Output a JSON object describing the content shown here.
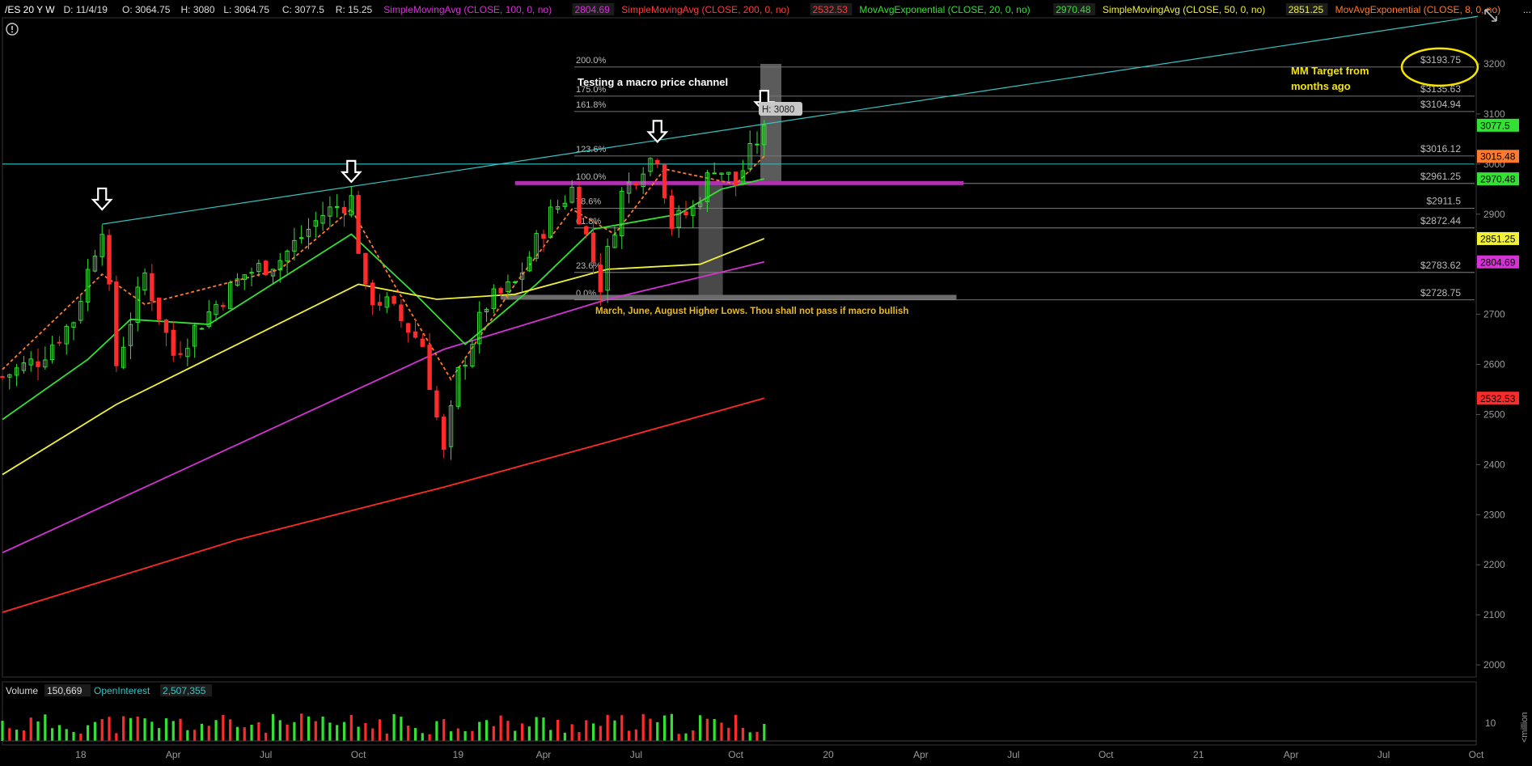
{
  "header": {
    "symbol": "/ES 20 Y W",
    "ohlc": [
      {
        "text": "D: 11/4/19",
        "color": "#dddddd"
      },
      {
        "text": "O: 3064.75",
        "color": "#dddddd"
      },
      {
        "text": "H: 3080",
        "color": "#dddddd"
      },
      {
        "text": "L: 3064.75",
        "color": "#dddddd"
      },
      {
        "text": "C: 3077.5",
        "color": "#dddddd"
      },
      {
        "text": "R: 15.25",
        "color": "#dddddd"
      }
    ],
    "studies": [
      {
        "label": "SimpleMovingAvg (CLOSE, 100, 0, no)",
        "value": "2804.69",
        "color": "#d633d6"
      },
      {
        "label": "SimpleMovingAvg (CLOSE, 200, 0, no)",
        "value": "2532.53",
        "color": "#ff3b3b"
      },
      {
        "label": "MovAvgExponential (CLOSE, 20, 0, no)",
        "value": "2970.48",
        "color": "#35e035"
      },
      {
        "label": "SimpleMovingAvg (CLOSE, 50, 0, no)",
        "value": "2851.25",
        "color": "#f0f03a"
      },
      {
        "label": "MovAvgExponential (CLOSE, 8, 0, no)",
        "value": "",
        "color": "#ff7a2a"
      }
    ],
    "more": "..."
  },
  "info_icon": "alert-circle-icon",
  "collapse_icon": "collapse-arrows-icon",
  "chart_data": {
    "type": "candlestick",
    "timeframe": "Weekly",
    "price_axis": {
      "range": [
        1950,
        3290
      ],
      "ticks": [
        2000,
        2100,
        2200,
        2300,
        2400,
        2500,
        2600,
        2700,
        2800,
        2900,
        3000,
        3100,
        3200
      ]
    },
    "x_axis": {
      "range": [
        "2017-10-16",
        "2021-10-04"
      ],
      "ticks": [
        {
          "label": "18",
          "date": "2018-01-01"
        },
        {
          "label": "Apr",
          "date": "2018-04-02"
        },
        {
          "label": "Jul",
          "date": "2018-07-02"
        },
        {
          "label": "Oct",
          "date": "2018-10-01"
        },
        {
          "label": "19",
          "date": "2019-01-07"
        },
        {
          "label": "Apr",
          "date": "2019-04-01"
        },
        {
          "label": "Jul",
          "date": "2019-07-01"
        },
        {
          "label": "Oct",
          "date": "2019-10-07"
        },
        {
          "label": "20",
          "date": "2020-01-06"
        },
        {
          "label": "Apr",
          "date": "2020-04-06"
        },
        {
          "label": "Jul",
          "date": "2020-07-06"
        },
        {
          "label": "Oct",
          "date": "2020-10-05"
        },
        {
          "label": "21",
          "date": "2021-01-04"
        },
        {
          "label": "Apr",
          "date": "2021-04-05"
        },
        {
          "label": "Jul",
          "date": "2021-07-05"
        },
        {
          "label": "Oct",
          "date": "2021-10-04"
        }
      ]
    },
    "price_path": [
      {
        "date": "2017-10-16",
        "close": 2575
      },
      {
        "date": "2017-11-20",
        "close": 2610
      },
      {
        "date": "2017-12-25",
        "close": 2690
      },
      {
        "date": "2018-01-22",
        "close": 2880
      },
      {
        "date": "2018-02-05",
        "close": 2600
      },
      {
        "date": "2018-03-05",
        "close": 2780
      },
      {
        "date": "2018-04-02",
        "close": 2620
      },
      {
        "date": "2018-05-14",
        "close": 2720
      },
      {
        "date": "2018-06-11",
        "close": 2780
      },
      {
        "date": "2018-07-16",
        "close": 2810
      },
      {
        "date": "2018-08-27",
        "close": 2900
      },
      {
        "date": "2018-09-24",
        "close": 2930
      },
      {
        "date": "2018-10-08",
        "close": 2740
      },
      {
        "date": "2018-10-29",
        "close": 2720
      },
      {
        "date": "2018-12-03",
        "close": 2640
      },
      {
        "date": "2018-12-24",
        "close": 2420
      },
      {
        "date": "2019-01-07",
        "close": 2580
      },
      {
        "date": "2019-02-04",
        "close": 2720
      },
      {
        "date": "2019-03-04",
        "close": 2760
      },
      {
        "date": "2019-04-08",
        "close": 2900
      },
      {
        "date": "2019-04-29",
        "close": 2950
      },
      {
        "date": "2019-05-27",
        "close": 2760
      },
      {
        "date": "2019-06-17",
        "close": 2940
      },
      {
        "date": "2019-07-08",
        "close": 3000
      },
      {
        "date": "2019-07-22",
        "close": 3020
      },
      {
        "date": "2019-08-05",
        "close": 2880
      },
      {
        "date": "2019-08-26",
        "close": 2910
      },
      {
        "date": "2019-09-16",
        "close": 3000
      },
      {
        "date": "2019-10-07",
        "close": 2960
      },
      {
        "date": "2019-10-21",
        "close": 3020
      },
      {
        "date": "2019-11-04",
        "close": 3077.5
      }
    ],
    "moving_averages": [
      {
        "name": "SimpleMovingAvg (CLOSE, 100, 0, no)",
        "color": "#d633d6",
        "points": [
          [
            "2017-10-16",
            2224
          ],
          [
            "2018-06-04",
            2440
          ],
          [
            "2018-12-24",
            2630
          ],
          [
            "2019-06-03",
            2730
          ],
          [
            "2019-11-04",
            2804.69
          ]
        ]
      },
      {
        "name": "SimpleMovingAvg (CLOSE, 200, 0, no)",
        "color": "#ff2a2a",
        "points": [
          [
            "2017-10-16",
            2105
          ],
          [
            "2018-06-04",
            2250
          ],
          [
            "2018-12-24",
            2355
          ],
          [
            "2019-06-03",
            2445
          ],
          [
            "2019-11-04",
            2532.53
          ]
        ]
      },
      {
        "name": "MovAvgExponential (CLOSE, 20, 0, no)",
        "color": "#35e035",
        "points": [
          [
            "2017-10-16",
            2490
          ],
          [
            "2018-01-08",
            2610
          ],
          [
            "2018-02-19",
            2690
          ],
          [
            "2018-05-07",
            2680
          ],
          [
            "2018-09-24",
            2860
          ],
          [
            "2018-11-26",
            2740
          ],
          [
            "2019-01-14",
            2640
          ],
          [
            "2019-03-25",
            2760
          ],
          [
            "2019-05-20",
            2870
          ],
          [
            "2019-08-12",
            2900
          ],
          [
            "2019-09-23",
            2950
          ],
          [
            "2019-11-04",
            2970.48
          ]
        ]
      },
      {
        "name": "SimpleMovingAvg (CLOSE, 50, 0, no)",
        "color": "#f0f03a",
        "points": [
          [
            "2017-10-16",
            2380
          ],
          [
            "2018-02-05",
            2520
          ],
          [
            "2018-06-04",
            2640
          ],
          [
            "2018-10-01",
            2760
          ],
          [
            "2018-12-17",
            2730
          ],
          [
            "2019-03-04",
            2740
          ],
          [
            "2019-06-03",
            2790
          ],
          [
            "2019-09-02",
            2800
          ],
          [
            "2019-11-04",
            2851.25
          ]
        ]
      },
      {
        "name": "MovAvgExponential (CLOSE, 8, 0, no)",
        "color": "#ff7a2a",
        "dashed": true,
        "points": [
          [
            "2017-10-16",
            2590
          ],
          [
            "2018-01-22",
            2780
          ],
          [
            "2018-03-05",
            2720
          ],
          [
            "2018-07-16",
            2790
          ],
          [
            "2018-09-24",
            2910
          ],
          [
            "2018-11-05",
            2760
          ],
          [
            "2018-12-31",
            2570
          ],
          [
            "2019-03-04",
            2760
          ],
          [
            "2019-04-29",
            2910
          ],
          [
            "2019-06-10",
            2860
          ],
          [
            "2019-07-29",
            2990
          ],
          [
            "2019-10-07",
            2960
          ],
          [
            "2019-11-04",
            3015.48
          ]
        ]
      }
    ],
    "fibonacci": {
      "levels": [
        {
          "pct": "200.0%",
          "price": 3193.75,
          "label": "$3193.75"
        },
        {
          "pct": "175.0%",
          "price": 3135.63,
          "label": "$3135.63"
        },
        {
          "pct": "161.8%",
          "price": 3104.94,
          "label": "$3104.94"
        },
        {
          "pct": "123.6%",
          "price": 3016.12,
          "label": "$3016.12"
        },
        {
          "pct": "100.0%",
          "price": 2961.25,
          "label": "$2961.25"
        },
        {
          "pct": "78.6%",
          "price": 2911.5,
          "label": "$2911.5"
        },
        {
          "pct": "61.8%",
          "price": 2872.44,
          "label": "$2872.44"
        },
        {
          "pct": "23.6%",
          "price": 2783.62,
          "label": "$2783.62"
        },
        {
          "pct": "0.0%",
          "price": 2728.75,
          "label": "$2728.75"
        }
      ]
    },
    "price_badges": [
      {
        "value": "3077.5",
        "price": 3077.5,
        "bg": "#35e035",
        "fg": "#000000"
      },
      {
        "value": "3015.48",
        "price": 3015.48,
        "bg": "#ff7a2a",
        "fg": "#000000"
      },
      {
        "value": "2970.48",
        "price": 2970.48,
        "bg": "#35e035",
        "fg": "#000000"
      },
      {
        "value": "2851.25",
        "price": 2851.25,
        "bg": "#f0f03a",
        "fg": "#000000"
      },
      {
        "value": "2804.69",
        "price": 2804.69,
        "bg": "#d633d6",
        "fg": "#000000"
      },
      {
        "value": "2532.53",
        "price": 2532.53,
        "bg": "#ff2a2a",
        "fg": "#000000"
      }
    ],
    "annotations": {
      "channel_note": "Testing a macro price channel",
      "target_note_1": "MM Target from",
      "target_note_2": "months ago",
      "higher_lows_note": "March, June, August Higher Lows. Thou shall not pass if macro bullish",
      "cursor_label": "H: 3080"
    }
  },
  "volume_panel": {
    "label": "Volume",
    "value": "150,669",
    "oi_label": "OpenInterest",
    "oi_value": "2,507,355",
    "axis_tick": "10",
    "axis_unit": "<million"
  }
}
